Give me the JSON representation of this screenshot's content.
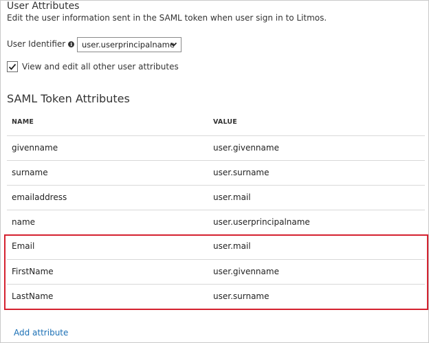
{
  "user_attributes": {
    "title": "User Attributes",
    "description": "Edit the user information sent in the SAML token when user sign in to Litmos.",
    "identifier_label": "User Identifier",
    "identifier_value": "user.userprincipalname",
    "checkbox_label": "View and edit all other user attributes",
    "checkbox_checked": true
  },
  "saml": {
    "title": "SAML Token Attributes",
    "columns": {
      "name": "NAME",
      "value": "VALUE"
    },
    "rows": [
      {
        "name": "givenname",
        "value": "user.givenname"
      },
      {
        "name": "surname",
        "value": "user.surname"
      },
      {
        "name": "emailaddress",
        "value": "user.mail"
      },
      {
        "name": "name",
        "value": "user.userprincipalname"
      },
      {
        "name": "Email",
        "value": "user.mail"
      },
      {
        "name": "FirstName",
        "value": "user.givenname"
      },
      {
        "name": "LastName",
        "value": "user.surname"
      }
    ],
    "add_attribute_label": "Add attribute"
  },
  "colors": {
    "highlight": "#d4202e",
    "link": "#1a6fb5"
  },
  "icons": {
    "info": "info-icon",
    "dropdown": "chevron-down-icon",
    "check": "checkmark-icon"
  }
}
